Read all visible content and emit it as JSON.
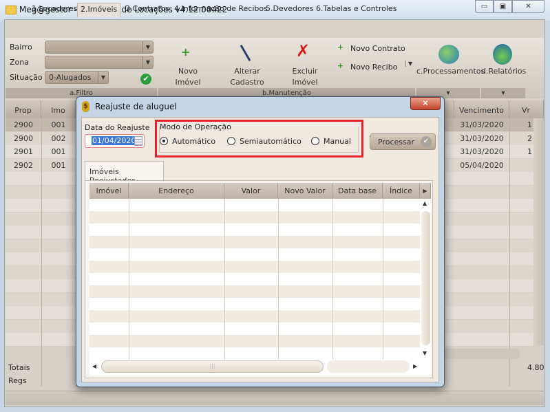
{
  "window": {
    "title": "Meg@gestor - Cobrança de Locações v4.12.00422",
    "minimize": "▭",
    "restore": "▣",
    "close": "✕"
  },
  "tabs": [
    {
      "label": "1.Locadores"
    },
    {
      "label": "2.Imóveis",
      "selected": true
    },
    {
      "label": "3.Contratos"
    },
    {
      "label": "4.Informação de Recibos"
    },
    {
      "label": "5.Devedores"
    },
    {
      "label": "6.Tabelas e Controles"
    }
  ],
  "filter": {
    "bairro_label": "Bairro",
    "bairro_value": "",
    "zona_label": "Zona",
    "zona_value": "",
    "situacao_label": "Situação",
    "situacao_value": "0-Alugados",
    "group_label": "a.Filtro"
  },
  "manutencao": {
    "novo_imovel": [
      "Novo",
      "Imóvel"
    ],
    "alterar": [
      "Alterar",
      "Cadastro"
    ],
    "excluir": [
      "Excluir",
      "Imóvel"
    ],
    "novo_contrato": "Novo Contrato",
    "novo_recibo": "Novo Recibo",
    "group_label": "b.Manutenção"
  },
  "processamentos": {
    "label": "c.Processamentos",
    "arrow": "▾"
  },
  "relatorios": {
    "label": "d.Relatórios",
    "arrow": "▾"
  },
  "grid": {
    "columns": [
      "Prop",
      "Imo",
      "Vencimento",
      "Vr"
    ],
    "rows": [
      {
        "prop": "2900",
        "imo": "001",
        "venc": "31/03/2020",
        "vr": "1"
      },
      {
        "prop": "2900",
        "imo": "002",
        "venc": "31/03/2020",
        "vr": "2"
      },
      {
        "prop": "2901",
        "imo": "001",
        "venc": "31/03/2020",
        "vr": "1"
      },
      {
        "prop": "2902",
        "imo": "001",
        "venc": "05/04/2020",
        "vr": ""
      }
    ],
    "totais_label": "Totais",
    "totais_value": "4.80",
    "regs_label": "Regs"
  },
  "dialog": {
    "title": "Reajuste de aluguel",
    "close": "✕",
    "data_label": "Data do Reajuste",
    "data_value": "01/04/2020",
    "modo_label": "Modo de Operação",
    "modes": [
      {
        "label": "Automático",
        "checked": true
      },
      {
        "label": "Semiautomático",
        "checked": false
      },
      {
        "label": "Manual",
        "checked": false
      }
    ],
    "processar": "Processar",
    "tab": "Imóveis Reajustados",
    "columns": [
      "Imóvel",
      "Endereço",
      "Valor",
      "Novo Valor",
      "Data base",
      "Índice"
    ],
    "highlight_color": "#e8202a"
  }
}
